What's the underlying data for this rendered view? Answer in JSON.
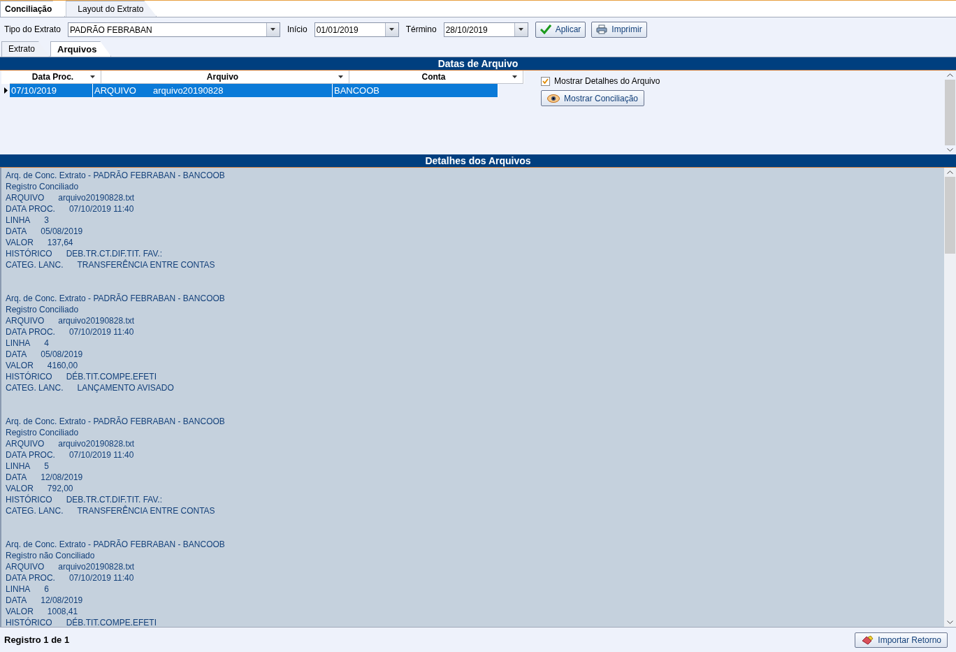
{
  "main_tabs": [
    {
      "label": "Conciliação",
      "selected": true
    },
    {
      "label": "Layout do Extrato",
      "selected": false
    }
  ],
  "toolbar": {
    "tipo_label": "Tipo do Extrato",
    "tipo_value": "PADRÃO FEBRABAN",
    "inicio_label": "Início",
    "inicio_value": "01/01/2019",
    "termino_label": "Término",
    "termino_value": "28/10/2019",
    "aplicar": "Aplicar",
    "imprimir": "Imprimir"
  },
  "sub_tabs": [
    {
      "label": "Extrato",
      "selected": false
    },
    {
      "label": "Arquivos",
      "selected": true
    }
  ],
  "datas_panel": {
    "title": "Datas de Arquivo",
    "columns": [
      "Data Proc.",
      "Arquivo",
      "Conta"
    ],
    "rows": [
      {
        "selected": true,
        "cells": [
          "07/10/2019",
          [
            "ARQUIVO",
            "arquivo20190828"
          ],
          "BANCOOB"
        ]
      }
    ],
    "show_details": {
      "label": "Mostrar Detalhes do Arquivo",
      "checked": true
    },
    "show_button": "Mostrar Conciliação"
  },
  "detalhes_panel": {
    "title": "Detalhes dos Arquivos",
    "records": [
      {
        "heading": "Arq. de Conc. Extrato - PADRÃO FEBRABAN - BANCOOB",
        "status": "Registro Conciliado",
        "fields": [
          [
            "ARQUIVO",
            "arquivo20190828.txt"
          ],
          [
            "DATA PROC.",
            "07/10/2019 11:40"
          ],
          [
            "LINHA",
            "3"
          ],
          [
            "DATA",
            "05/08/2019"
          ],
          [
            "VALOR",
            "137,64"
          ],
          [
            "HISTÓRICO",
            "DEB.TR.CT.DIF.TIT. FAV.:"
          ],
          [
            "CATEG. LANC.",
            "TRANSFERÊNCIA ENTRE CONTAS"
          ]
        ]
      },
      {
        "heading": "Arq. de Conc. Extrato - PADRÃO FEBRABAN - BANCOOB",
        "status": "Registro Conciliado",
        "fields": [
          [
            "ARQUIVO",
            "arquivo20190828.txt"
          ],
          [
            "DATA PROC.",
            "07/10/2019 11:40"
          ],
          [
            "LINHA",
            "4"
          ],
          [
            "DATA",
            "05/08/2019"
          ],
          [
            "VALOR",
            "4160,00"
          ],
          [
            "HISTÓRICO",
            "DÉB.TIT.COMPE.EFETI"
          ],
          [
            "CATEG. LANC.",
            "LANÇAMENTO AVISADO"
          ]
        ]
      },
      {
        "heading": "Arq. de Conc. Extrato - PADRÃO FEBRABAN - BANCOOB",
        "status": "Registro Conciliado",
        "fields": [
          [
            "ARQUIVO",
            "arquivo20190828.txt"
          ],
          [
            "DATA PROC.",
            "07/10/2019 11:40"
          ],
          [
            "LINHA",
            "5"
          ],
          [
            "DATA",
            "12/08/2019"
          ],
          [
            "VALOR",
            "792,00"
          ],
          [
            "HISTÓRICO",
            "DEB.TR.CT.DIF.TIT. FAV.:"
          ],
          [
            "CATEG. LANC.",
            "TRANSFERÊNCIA ENTRE CONTAS"
          ]
        ]
      },
      {
        "heading": "Arq. de Conc. Extrato - PADRÃO FEBRABAN - BANCOOB",
        "status": "Registro não Conciliado",
        "fields": [
          [
            "ARQUIVO",
            "arquivo20190828.txt"
          ],
          [
            "DATA PROC.",
            "07/10/2019 11:40"
          ],
          [
            "LINHA",
            "6"
          ],
          [
            "DATA",
            "12/08/2019"
          ],
          [
            "VALOR",
            "1008,41"
          ],
          [
            "HISTÓRICO",
            "DÉB.TIT.COMPE.EFETI"
          ]
        ]
      }
    ]
  },
  "status_bar": {
    "text": "Registro 1 de 1",
    "button": "Importar Retorno"
  }
}
